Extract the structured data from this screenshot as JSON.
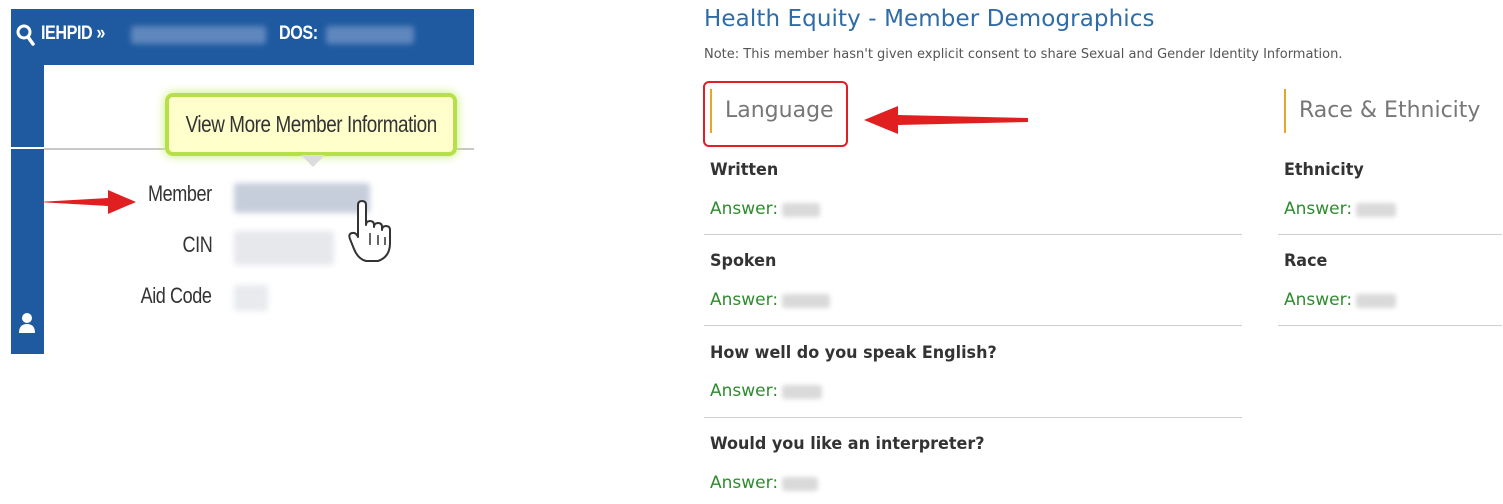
{
  "header": {
    "id_label": "IEHPID »",
    "dos_label": "DOS:"
  },
  "tooltip": {
    "text": "View More Member Information"
  },
  "member_fields": [
    {
      "label": "Member"
    },
    {
      "label": "CIN"
    },
    {
      "label": "Aid Code"
    }
  ],
  "demographics": {
    "title": "Health Equity - Member Demographics",
    "note": "Note: This member hasn't given explicit consent to share Sexual and Gender Identity Information.",
    "language": {
      "heading": "Language",
      "questions": [
        {
          "label": "Written",
          "answer_label": "Answer:"
        },
        {
          "label": "Spoken",
          "answer_label": "Answer:"
        },
        {
          "label": "How well do you speak English?",
          "answer_label": "Answer:"
        },
        {
          "label": "Would you like an interpreter?",
          "answer_label": "Answer:"
        }
      ]
    },
    "race_ethnicity": {
      "heading": "Race & Ethnicity",
      "questions": [
        {
          "label": "Ethnicity",
          "answer_label": "Answer:"
        },
        {
          "label": "Race",
          "answer_label": "Answer:"
        }
      ]
    }
  },
  "colors": {
    "header_blue": "#1f5aa0",
    "title_blue": "#2f6ca7",
    "answer_green": "#2e8b2e",
    "accent_orange": "#e8a628",
    "annotation_red": "#e02020",
    "tooltip_yellow": "#ffffcc",
    "tooltip_border": "#b6e04a"
  },
  "icons": [
    "search-icon",
    "user-icon",
    "hand-pointer-icon",
    "red-arrow-icon"
  ]
}
